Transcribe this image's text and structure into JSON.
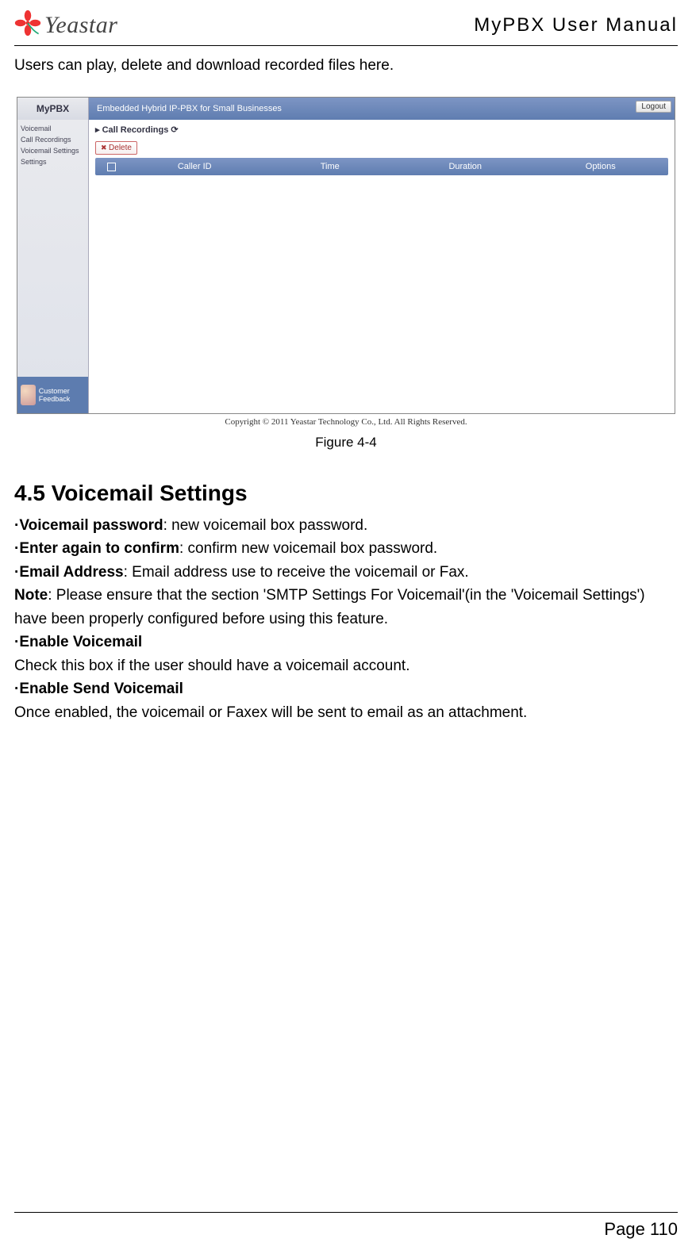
{
  "header": {
    "brand": "Yeastar",
    "manual_title": "MyPBX  User  Manual"
  },
  "intro": "Users can play, delete and download recorded files here.",
  "screenshot": {
    "app_logo": "MyPBX",
    "banner_text": "Embedded Hybrid IP-PBX for Small Businesses",
    "logout": "Logout",
    "sidebar": {
      "items": [
        "Voicemail",
        "Call Recordings",
        "Voicemail Settings",
        "Settings"
      ],
      "feedback": "Customer Feedback"
    },
    "breadcrumb": "Call Recordings ⟳",
    "delete_btn": "Delete",
    "columns": {
      "caller_id": "Caller ID",
      "time": "Time",
      "duration": "Duration",
      "options": "Options"
    },
    "copyright": "Copyright © 2011 Yeastar Technology Co., Ltd. All Rights Reserved."
  },
  "figure_caption": "Figure 4-4",
  "section": {
    "heading": "4.5 Voicemail Settings",
    "line1_b": "·Voicemail password",
    "line1": ": new voicemail box password.",
    "line2_b": "·Enter again to confirm",
    "line2": ": confirm new voicemail box password.",
    "line3_b": "·Email Address",
    "line3": ": Email address use to receive the voicemail or Fax.",
    "note_b": "Note",
    "note": ": Please ensure that the section 'SMTP Settings For Voicemail'(in the 'Voicemail Settings') have been properly configured before using this feature.",
    "line4_b": "·Enable Voicemail",
    "line4": "Check this box if the user should have a voicemail account.",
    "line5_b": "·Enable Send Voicemail",
    "line5": "Once enabled, the voicemail or Faxex will be sent to email as an attachment."
  },
  "footer": {
    "page_number": "Page 110"
  }
}
